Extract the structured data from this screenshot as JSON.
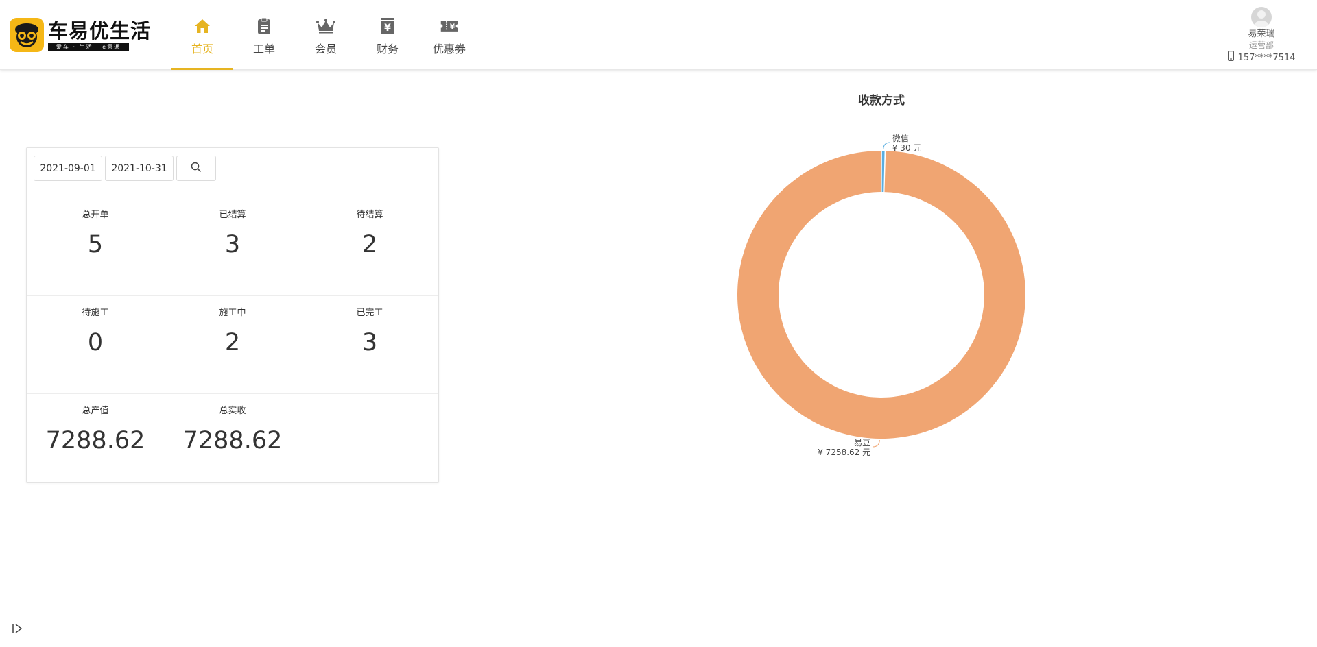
{
  "brand": {
    "name": "车易优生活",
    "subtitle": "爱车 · 生活 · e意通"
  },
  "nav": {
    "items": [
      {
        "label": "首页",
        "icon": "home-icon",
        "active": true
      },
      {
        "label": "工单",
        "icon": "clipboard-icon",
        "active": false
      },
      {
        "label": "会员",
        "icon": "crown-icon",
        "active": false
      },
      {
        "label": "财务",
        "icon": "finance-icon",
        "active": false
      },
      {
        "label": "优惠券",
        "icon": "coupon-icon",
        "active": false
      }
    ],
    "accent": "#e6b422"
  },
  "user": {
    "name": "易荣瑞",
    "dept": "运营部",
    "phone": "157****7514"
  },
  "filters": {
    "start_date": "2021-09-01",
    "end_date": "2021-10-31"
  },
  "stats": {
    "total_orders": {
      "label": "总开单",
      "value": "5"
    },
    "settled": {
      "label": "已结算",
      "value": "3"
    },
    "pending_settle": {
      "label": "待结算",
      "value": "2"
    },
    "pending_work": {
      "label": "待施工",
      "value": "0"
    },
    "in_progress": {
      "label": "施工中",
      "value": "2"
    },
    "completed": {
      "label": "已完工",
      "value": "3"
    },
    "total_output": {
      "label": "总产值",
      "value": "7288.62"
    },
    "total_received": {
      "label": "总实收",
      "value": "7288.62"
    }
  },
  "chart_data": {
    "type": "pie",
    "title": "收款方式",
    "donut": true,
    "series": [
      {
        "name": "微信",
        "value": 30,
        "label": "¥ 30 元",
        "color": "#5aaee0"
      },
      {
        "name": "易豆",
        "value": 7258.62,
        "label": "¥ 7258.62 元",
        "color": "#f0a572"
      }
    ]
  }
}
